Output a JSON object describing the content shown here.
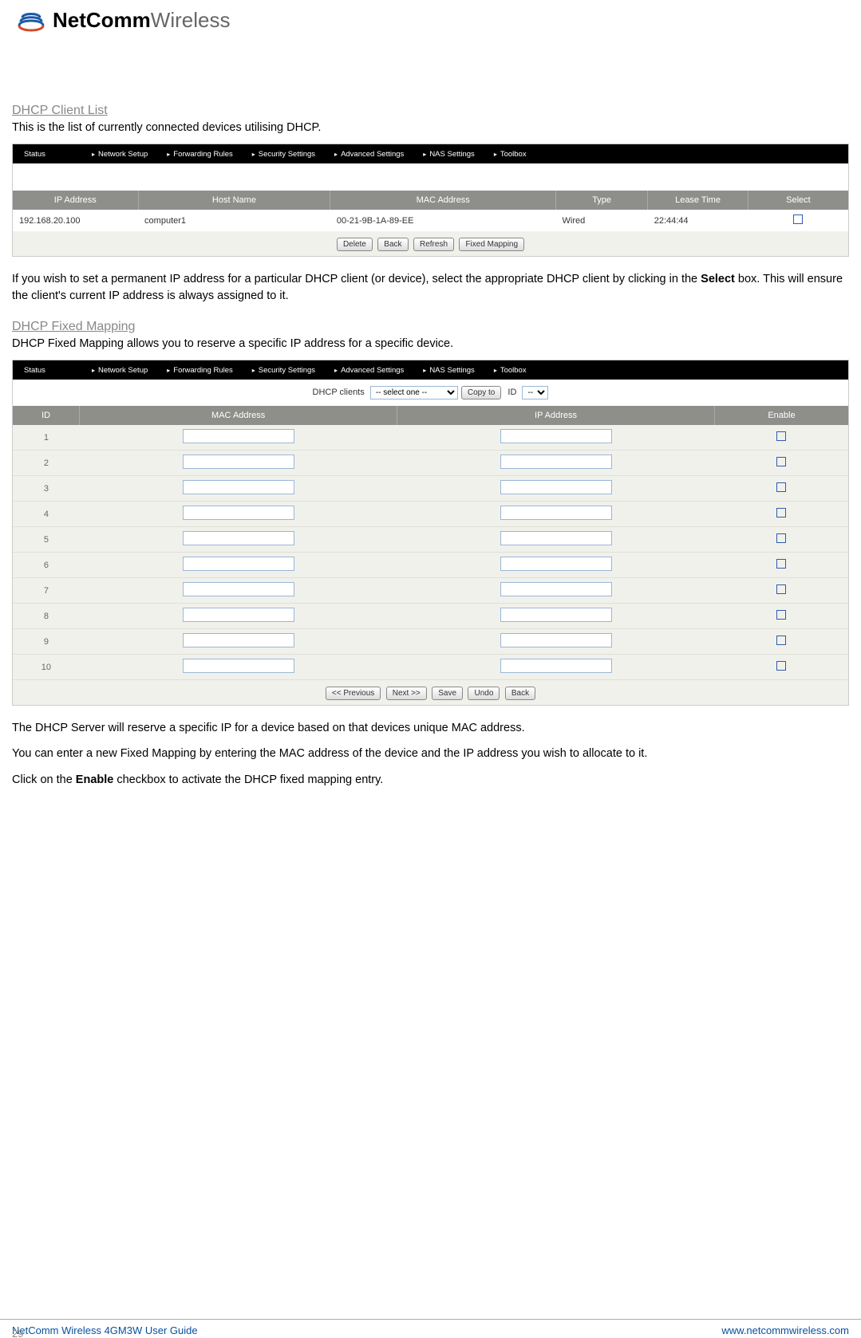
{
  "brand": {
    "bold": "NetComm",
    "light": "Wireless"
  },
  "section1": {
    "title": "DHCP Client List",
    "desc1": "This is the list of currently connected devices utilising DHCP.",
    "desc2_a": "If you wish to set a permanent IP address for a particular DHCP client (or device), select the appropriate DHCP client by clicking in the ",
    "desc2_bold": "Select",
    "desc2_b": " box. This will ensure the client's current IP address is always assigned to it."
  },
  "nav": {
    "items": [
      "Status",
      "Network Setup",
      "Forwarding Rules",
      "Security Settings",
      "Advanced Settings",
      "NAS Settings",
      "Toolbox"
    ]
  },
  "table1": {
    "headers": [
      "IP Address",
      "Host Name",
      "MAC Address",
      "Type",
      "Lease Time",
      "Select"
    ],
    "row": {
      "ip": "192.168.20.100",
      "host": "computer1",
      "mac": "00-21-9B-1A-89-EE",
      "type": "Wired",
      "lease": "22:44:44"
    },
    "buttons": [
      "Delete",
      "Back",
      "Refresh",
      "Fixed Mapping"
    ]
  },
  "section2": {
    "title": "DHCP Fixed Mapping",
    "desc1": "DHCP Fixed Mapping allows you to reserve a specific IP address for a specific device.",
    "copy_label": "DHCP clients",
    "select_one": "-- select one --",
    "copyto": "Copy to",
    "id_label": "ID",
    "id_dash": "--"
  },
  "table2": {
    "headers": [
      "ID",
      "MAC Address",
      "IP Address",
      "Enable"
    ],
    "ids": [
      "1",
      "2",
      "3",
      "4",
      "5",
      "6",
      "7",
      "8",
      "9",
      "10"
    ],
    "buttons": [
      "<< Previous",
      "Next >>",
      "Save",
      "Undo",
      "Back"
    ]
  },
  "section3": {
    "p1": "The DHCP Server will reserve a specific IP for a device based on that devices unique MAC address.",
    "p2": "You can enter a new Fixed Mapping by entering the MAC address of the device and the IP address you wish to allocate to it.",
    "p3_a": "Click on the ",
    "p3_bold": "Enable",
    "p3_b": " checkbox to activate the DHCP fixed mapping entry."
  },
  "footer": {
    "left": "NetComm Wireless 4GM3W User Guide",
    "right": "www.netcommwireless.com",
    "page": "29"
  }
}
